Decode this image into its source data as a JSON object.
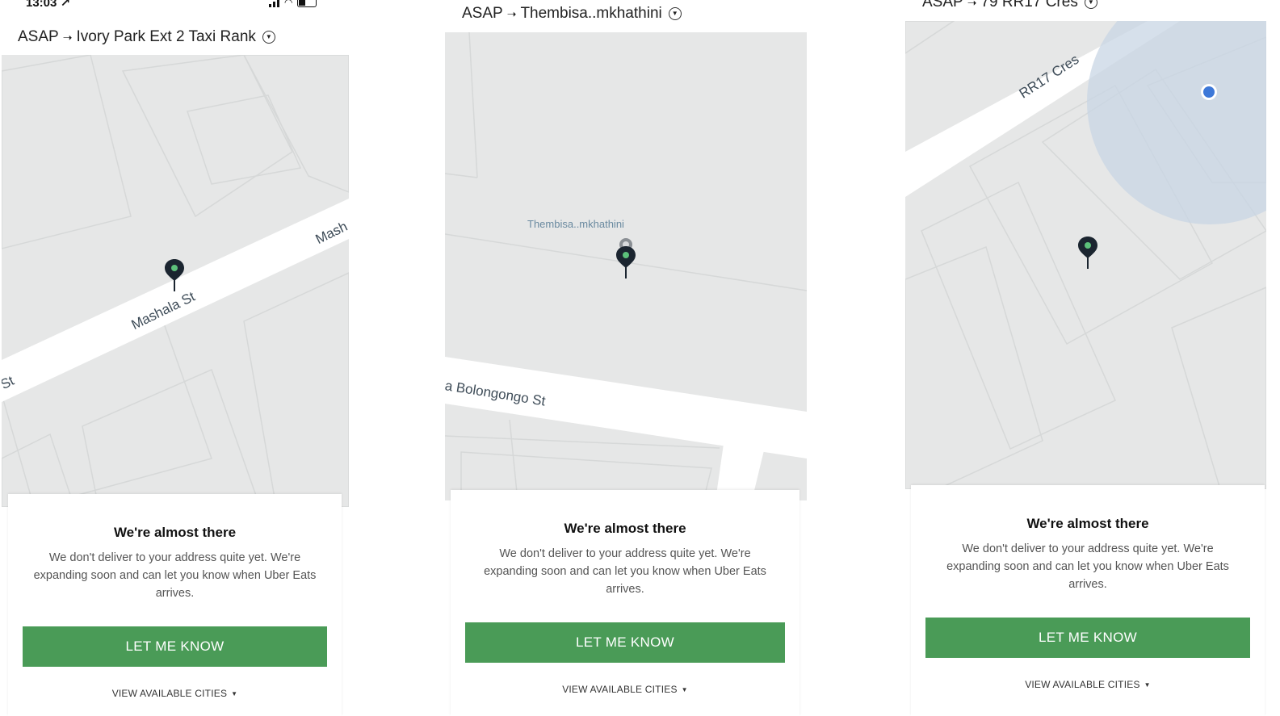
{
  "status": {
    "time": "13:03 ↗"
  },
  "screens": [
    {
      "when": "ASAP",
      "arrow": "➝",
      "destination": "Ivory Park Ext 2 Taxi Rank",
      "streets": [
        "Mashala St",
        "Mash",
        "St"
      ],
      "card": {
        "title": "We're almost there",
        "body": "We don't deliver to your address quite yet. We're expanding soon and can let you know when Uber Eats arrives.",
        "button": "LET ME KNOW",
        "cities": "VIEW AVAILABLE CITIES"
      }
    },
    {
      "when": "ASAP",
      "arrow": "➝",
      "destination": "Thembisa..mkhathini",
      "place_label": "Thembisa..mkhathini",
      "streets": [
        "a Bolongongo St"
      ],
      "card": {
        "title": "We're almost there",
        "body": "We don't deliver to your address quite yet. We're expanding soon and can let you know when Uber Eats arrives.",
        "button": "LET ME KNOW",
        "cities": "VIEW AVAILABLE CITIES"
      }
    },
    {
      "when": "ASAP",
      "arrow": "➝",
      "destination": "79 RR17 Cres",
      "streets": [
        "RR17 Cres"
      ],
      "card": {
        "title": "We're almost there",
        "body": "We don't deliver to your address quite yet. We're expanding soon and can let you know when Uber Eats arrives.",
        "button": "LET ME KNOW",
        "cities": "VIEW AVAILABLE CITIES"
      }
    }
  ],
  "colors": {
    "button": "#4a9b57",
    "map": "#e6e7e7",
    "pin": "#1b2530",
    "pin_dot": "#5cc07a",
    "location": "#3d78d8"
  }
}
